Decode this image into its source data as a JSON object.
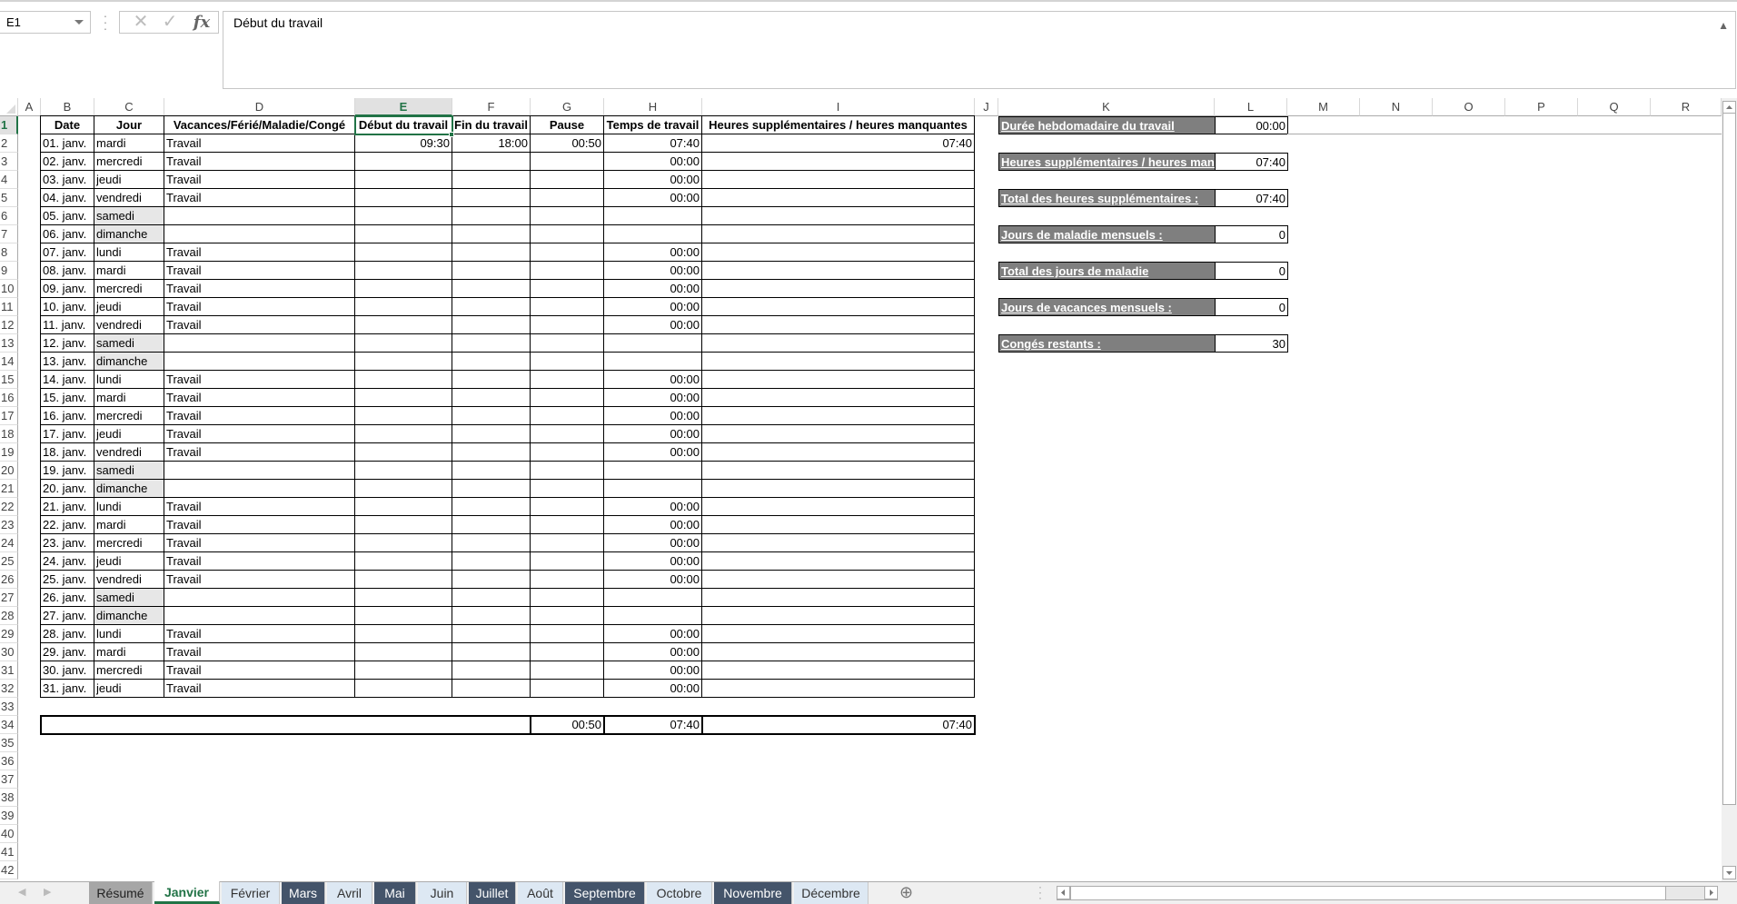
{
  "formula_bar": {
    "name_box": "E1",
    "cancel_icon": "✕",
    "enter_icon": "✓",
    "fx_label": "fx",
    "content": "Début du travail"
  },
  "columns": [
    "A",
    "B",
    "C",
    "D",
    "E",
    "F",
    "G",
    "H",
    "I",
    "J",
    "K",
    "L",
    "M",
    "N",
    "O",
    "P",
    "Q",
    "R"
  ],
  "selected_cell": "E1",
  "table": {
    "headers": [
      "Date",
      "Jour",
      "Vacances/Férié/Maladie/Congé",
      "Début du travail",
      "Fin du travail",
      "Pause",
      "Temps de travail",
      "Heures supplémentaires / heures manquantes"
    ],
    "rows": [
      {
        "date": "01. janv.",
        "day": "mardi",
        "type": "Travail",
        "start": "09:30",
        "end": "18:00",
        "pause": "00:50",
        "worktime": "07:40",
        "overtime": "07:40",
        "weekend": false
      },
      {
        "date": "02. janv.",
        "day": "mercredi",
        "type": "Travail",
        "start": "",
        "end": "",
        "pause": "",
        "worktime": "00:00",
        "overtime": "",
        "weekend": false
      },
      {
        "date": "03. janv.",
        "day": "jeudi",
        "type": "Travail",
        "start": "",
        "end": "",
        "pause": "",
        "worktime": "00:00",
        "overtime": "",
        "weekend": false
      },
      {
        "date": "04. janv.",
        "day": "vendredi",
        "type": "Travail",
        "start": "",
        "end": "",
        "pause": "",
        "worktime": "00:00",
        "overtime": "",
        "weekend": false
      },
      {
        "date": "05. janv.",
        "day": "samedi",
        "type": "",
        "start": "",
        "end": "",
        "pause": "",
        "worktime": "",
        "overtime": "",
        "weekend": true
      },
      {
        "date": "06. janv.",
        "day": "dimanche",
        "type": "",
        "start": "",
        "end": "",
        "pause": "",
        "worktime": "",
        "overtime": "",
        "weekend": true
      },
      {
        "date": "07. janv.",
        "day": "lundi",
        "type": "Travail",
        "start": "",
        "end": "",
        "pause": "",
        "worktime": "00:00",
        "overtime": "",
        "weekend": false
      },
      {
        "date": "08. janv.",
        "day": "mardi",
        "type": "Travail",
        "start": "",
        "end": "",
        "pause": "",
        "worktime": "00:00",
        "overtime": "",
        "weekend": false
      },
      {
        "date": "09. janv.",
        "day": "mercredi",
        "type": "Travail",
        "start": "",
        "end": "",
        "pause": "",
        "worktime": "00:00",
        "overtime": "",
        "weekend": false
      },
      {
        "date": "10. janv.",
        "day": "jeudi",
        "type": "Travail",
        "start": "",
        "end": "",
        "pause": "",
        "worktime": "00:00",
        "overtime": "",
        "weekend": false
      },
      {
        "date": "11. janv.",
        "day": "vendredi",
        "type": "Travail",
        "start": "",
        "end": "",
        "pause": "",
        "worktime": "00:00",
        "overtime": "",
        "weekend": false
      },
      {
        "date": "12. janv.",
        "day": "samedi",
        "type": "",
        "start": "",
        "end": "",
        "pause": "",
        "worktime": "",
        "overtime": "",
        "weekend": true
      },
      {
        "date": "13. janv.",
        "day": "dimanche",
        "type": "",
        "start": "",
        "end": "",
        "pause": "",
        "worktime": "",
        "overtime": "",
        "weekend": true
      },
      {
        "date": "14. janv.",
        "day": "lundi",
        "type": "Travail",
        "start": "",
        "end": "",
        "pause": "",
        "worktime": "00:00",
        "overtime": "",
        "weekend": false
      },
      {
        "date": "15. janv.",
        "day": "mardi",
        "type": "Travail",
        "start": "",
        "end": "",
        "pause": "",
        "worktime": "00:00",
        "overtime": "",
        "weekend": false
      },
      {
        "date": "16. janv.",
        "day": "mercredi",
        "type": "Travail",
        "start": "",
        "end": "",
        "pause": "",
        "worktime": "00:00",
        "overtime": "",
        "weekend": false
      },
      {
        "date": "17. janv.",
        "day": "jeudi",
        "type": "Travail",
        "start": "",
        "end": "",
        "pause": "",
        "worktime": "00:00",
        "overtime": "",
        "weekend": false
      },
      {
        "date": "18. janv.",
        "day": "vendredi",
        "type": "Travail",
        "start": "",
        "end": "",
        "pause": "",
        "worktime": "00:00",
        "overtime": "",
        "weekend": false
      },
      {
        "date": "19. janv.",
        "day": "samedi",
        "type": "",
        "start": "",
        "end": "",
        "pause": "",
        "worktime": "",
        "overtime": "",
        "weekend": true
      },
      {
        "date": "20. janv.",
        "day": "dimanche",
        "type": "",
        "start": "",
        "end": "",
        "pause": "",
        "worktime": "",
        "overtime": "",
        "weekend": true
      },
      {
        "date": "21. janv.",
        "day": "lundi",
        "type": "Travail",
        "start": "",
        "end": "",
        "pause": "",
        "worktime": "00:00",
        "overtime": "",
        "weekend": false
      },
      {
        "date": "22. janv.",
        "day": "mardi",
        "type": "Travail",
        "start": "",
        "end": "",
        "pause": "",
        "worktime": "00:00",
        "overtime": "",
        "weekend": false
      },
      {
        "date": "23. janv.",
        "day": "mercredi",
        "type": "Travail",
        "start": "",
        "end": "",
        "pause": "",
        "worktime": "00:00",
        "overtime": "",
        "weekend": false
      },
      {
        "date": "24. janv.",
        "day": "jeudi",
        "type": "Travail",
        "start": "",
        "end": "",
        "pause": "",
        "worktime": "00:00",
        "overtime": "",
        "weekend": false
      },
      {
        "date": "25. janv.",
        "day": "vendredi",
        "type": "Travail",
        "start": "",
        "end": "",
        "pause": "",
        "worktime": "00:00",
        "overtime": "",
        "weekend": false
      },
      {
        "date": "26. janv.",
        "day": "samedi",
        "type": "",
        "start": "",
        "end": "",
        "pause": "",
        "worktime": "",
        "overtime": "",
        "weekend": true
      },
      {
        "date": "27. janv.",
        "day": "dimanche",
        "type": "",
        "start": "",
        "end": "",
        "pause": "",
        "worktime": "",
        "overtime": "",
        "weekend": true
      },
      {
        "date": "28. janv.",
        "day": "lundi",
        "type": "Travail",
        "start": "",
        "end": "",
        "pause": "",
        "worktime": "00:00",
        "overtime": "",
        "weekend": false
      },
      {
        "date": "29. janv.",
        "day": "mardi",
        "type": "Travail",
        "start": "",
        "end": "",
        "pause": "",
        "worktime": "00:00",
        "overtime": "",
        "weekend": false
      },
      {
        "date": "30. janv.",
        "day": "mercredi",
        "type": "Travail",
        "start": "",
        "end": "",
        "pause": "",
        "worktime": "00:00",
        "overtime": "",
        "weekend": false
      },
      {
        "date": "31. janv.",
        "day": "jeudi",
        "type": "Travail",
        "start": "",
        "end": "",
        "pause": "",
        "worktime": "00:00",
        "overtime": "",
        "weekend": false
      }
    ],
    "totals": {
      "pause": "00:50",
      "worktime": "07:40",
      "overtime": "07:40"
    }
  },
  "summary": [
    {
      "label": "Durée hebdomadaire du travail",
      "value": "00:00"
    },
    {
      "label": "Heures supplémentaires / heures manquantes",
      "value": "07:40"
    },
    {
      "label": "Total des heures supplémentaires :",
      "value": "07:40"
    },
    {
      "label": "Jours de maladie mensuels :",
      "value": "0"
    },
    {
      "label": "Total des jours de maladie",
      "value": "0"
    },
    {
      "label": "Jours de vacances mensuels :",
      "value": "0"
    },
    {
      "label": "Congés restants :",
      "value": "30"
    }
  ],
  "row_count": 42,
  "sheet_tabs": [
    {
      "label": "Résumé",
      "style": "gray"
    },
    {
      "label": "Janvier",
      "style": "active"
    },
    {
      "label": "Février",
      "style": "light"
    },
    {
      "label": "Mars",
      "style": "dark"
    },
    {
      "label": "Avril",
      "style": "light"
    },
    {
      "label": "Mai",
      "style": "dark"
    },
    {
      "label": "Juin",
      "style": "light"
    },
    {
      "label": "Juillet",
      "style": "dark"
    },
    {
      "label": "Août",
      "style": "light"
    },
    {
      "label": "Septembre",
      "style": "dark"
    },
    {
      "label": "Octobre",
      "style": "light"
    },
    {
      "label": "Novembre",
      "style": "dark"
    },
    {
      "label": "Décembre",
      "style": "light"
    }
  ],
  "add_sheet_icon": "⊕",
  "colors": {
    "accent": "#217346",
    "summary_label_bg": "#7f7f7f",
    "weekend_bg": "#e7e7e7",
    "tab_dark": "#44546a",
    "tab_light": "#dde8f3"
  }
}
